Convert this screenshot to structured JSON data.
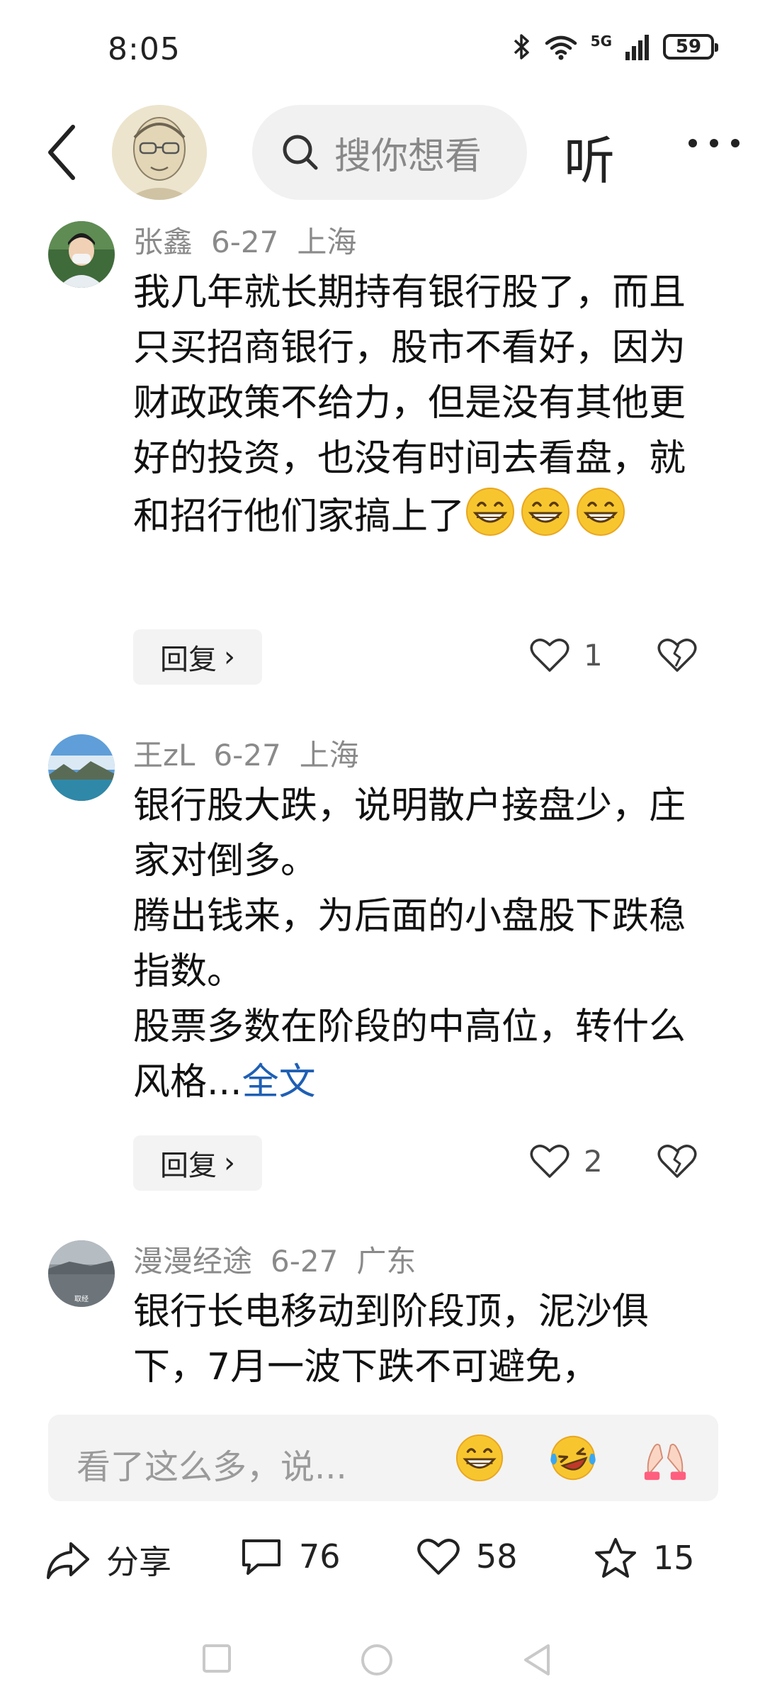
{
  "status_bar": {
    "time": "8:05",
    "network": "5G",
    "battery": "59"
  },
  "header": {
    "search_placeholder": "搜你想看",
    "listen_label": "听"
  },
  "comments": [
    {
      "author": "张鑫",
      "date": "6-27",
      "location": "上海",
      "text": "我几年就长期持有银行股了，而且只买招商银行，股市不看好，因为财政政策不给力，但是没有其他更好的投资，也没有时间去看盘，就和招行他们家搞上了",
      "reply_label": "回复",
      "likes": "1"
    },
    {
      "author": "王zL",
      "date": "6-27",
      "location": "上海",
      "lines": [
        "银行股大跌，说明散户接盘少，庄家对倒多。",
        "腾出钱来，为后面的小盘股下跌稳指数。",
        "股票多数在阶段的中高位，转什么风格..."
      ],
      "more_link": "全文",
      "reply_label": "回复",
      "likes": "2"
    },
    {
      "author": "漫漫经途",
      "date": "6-27",
      "location": "广东",
      "text": "银行长电移动到阶段顶，泥沙俱下，7月一波下跌不可避免，"
    }
  ],
  "comment_input": {
    "placeholder": "看了这么多，说..."
  },
  "actions": {
    "share_label": "分享",
    "comments_count": "76",
    "likes_count": "58",
    "favorites_count": "15"
  },
  "avatars": {
    "third_avatar_caption": "取经"
  }
}
